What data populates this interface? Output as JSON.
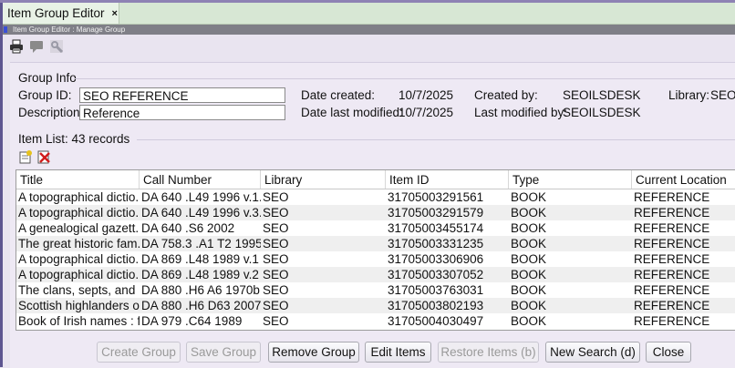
{
  "tab": {
    "title": "Item Group Editor",
    "close": "×"
  },
  "breadcrumb": "Item Group Editor : Manage Group",
  "toolbar": {
    "icons": [
      "printer-icon",
      "comment-icon",
      "tools-icon"
    ]
  },
  "group_info": {
    "legend": "Group Info",
    "group_id_label": "Group ID:",
    "group_id_value": "SEO REFERENCE",
    "description_label": "Description:",
    "description_value": "Reference",
    "date_created_label": "Date created:",
    "date_created_value": "10/7/2025",
    "date_modified_label": "Date last modified:",
    "date_modified_value": "10/7/2025",
    "created_by_label": "Created by:",
    "created_by_value": "SEOILSDESK",
    "modified_by_label": "Last modified by:",
    "modified_by_value": "SEOILSDESK",
    "library_label": "Library:",
    "library_value": "SEO"
  },
  "item_list": {
    "legend": "Item List: 43 records",
    "columns": [
      "Title",
      "Call Number",
      "Library",
      "Item ID",
      "Type",
      "Current Location"
    ],
    "rows": [
      [
        "A topographical dictio...",
        "DA 640 .L49 1996 v.1...",
        "SEO",
        "31705003291561",
        "BOOK",
        "REFERENCE"
      ],
      [
        "A topographical dictio...",
        "DA 640 .L49 1996 v.3...",
        "SEO",
        "31705003291579",
        "BOOK",
        "REFERENCE"
      ],
      [
        "A genealogical gazett...",
        "DA 640 .S6 2002",
        "SEO",
        "31705003455174",
        "BOOK",
        "REFERENCE"
      ],
      [
        "The great historic fam...",
        "DA 758.3 .A1 T2 1995",
        "SEO",
        "31705003331235",
        "BOOK",
        "REFERENCE"
      ],
      [
        "A topographical dictio...",
        "DA 869 .L48 1989 v.1",
        "SEO",
        "31705003306906",
        "BOOK",
        "REFERENCE"
      ],
      [
        "A topographical dictio...",
        "DA 869 .L48 1989 v.2",
        "SEO",
        "31705003307052",
        "BOOK",
        "REFERENCE"
      ],
      [
        "The clans, septs, and ...",
        "DA 880 .H6 A6 1970b",
        "SEO",
        "31705003763031",
        "BOOK",
        "REFERENCE"
      ],
      [
        "Scottish highlanders o...",
        "DA 880 .H6 D63 2007",
        "SEO",
        "31705003802193",
        "BOOK",
        "REFERENCE"
      ],
      [
        "Book of Irish names : f...",
        "DA 979 .C64 1989",
        "SEO",
        "31705004030497",
        "BOOK",
        "REFERENCE"
      ]
    ]
  },
  "buttons": {
    "create_group": "Create Group",
    "save_group": "Save Group",
    "remove_group": "Remove Group",
    "edit_items": "Edit Items",
    "restore_items": "Restore Items (b)",
    "new_search": "New Search (d)",
    "close": "Close"
  }
}
